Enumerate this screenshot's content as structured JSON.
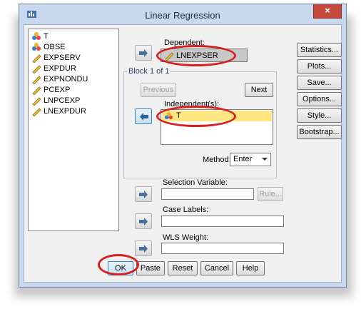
{
  "window": {
    "title": "Linear Regression",
    "close_glyph": "×"
  },
  "variables": [
    {
      "name": "T",
      "icon": "nominal-icon"
    },
    {
      "name": "OBSE",
      "icon": "nominal-icon"
    },
    {
      "name": "EXPSERV",
      "icon": "scale-icon"
    },
    {
      "name": "EXPDUR",
      "icon": "scale-icon"
    },
    {
      "name": "EXPNONDU",
      "icon": "scale-icon"
    },
    {
      "name": "PCEXP",
      "icon": "scale-icon"
    },
    {
      "name": "LNPCEXP",
      "icon": "scale-icon"
    },
    {
      "name": "LNEXPDUR",
      "icon": "scale-icon"
    }
  ],
  "dependent": {
    "label": "Dependent:",
    "value": "LNEXPSER"
  },
  "block": {
    "title": "Block 1 of 1",
    "previous": "Previous",
    "next": "Next"
  },
  "independent": {
    "label": "Independent(s):",
    "items": [
      "T"
    ]
  },
  "method": {
    "label": "Method:",
    "value": "Enter"
  },
  "selection": {
    "label": "Selection Variable:",
    "rule": "Rule..."
  },
  "case_labels": {
    "label": "Case Labels:"
  },
  "wls": {
    "label": "WLS Weight:"
  },
  "side_buttons": [
    "Statistics...",
    "Plots...",
    "Save...",
    "Options...",
    "Style...",
    "Bootstrap..."
  ],
  "bottom_buttons": [
    "OK",
    "Paste",
    "Reset",
    "Cancel",
    "Help"
  ],
  "colors": {
    "highlight": "#ffe680",
    "annotation": "#d61f1f",
    "close": "#c44a3e"
  }
}
